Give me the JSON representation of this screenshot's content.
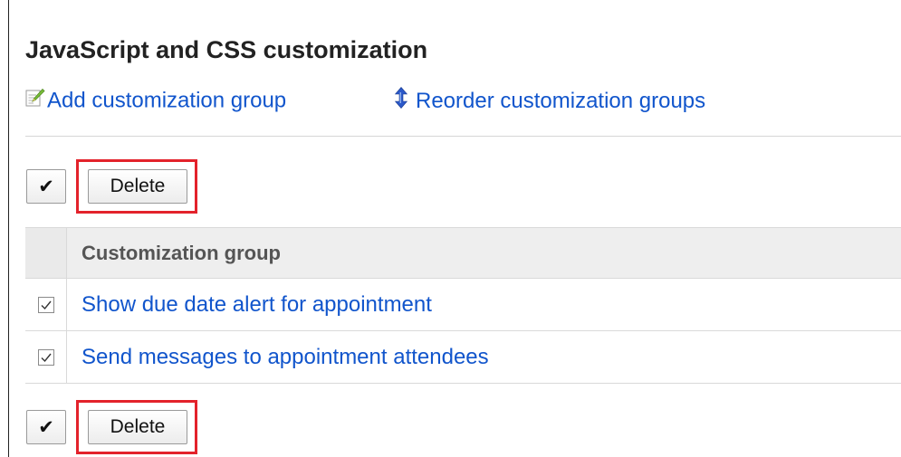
{
  "page": {
    "title": "JavaScript and CSS customization"
  },
  "actions": {
    "add_label": "Add customization group",
    "reorder_label": "Reorder customization groups",
    "add_icon": "edit-pencil-icon",
    "reorder_icon": "up-down-arrow-icon"
  },
  "toolbar_top": {
    "check_glyph": "✔",
    "delete_label": "Delete"
  },
  "toolbar_bottom": {
    "check_glyph": "✔",
    "delete_label": "Delete"
  },
  "table": {
    "column_header": "Customization group",
    "rows": [
      {
        "name": "Show due date alert for appointment",
        "checked": true
      },
      {
        "name": "Send messages to appointment attendees",
        "checked": true
      }
    ]
  },
  "colors": {
    "link": "#1155cc",
    "highlight": "#e3222b",
    "header_bg": "#eeeeee"
  }
}
